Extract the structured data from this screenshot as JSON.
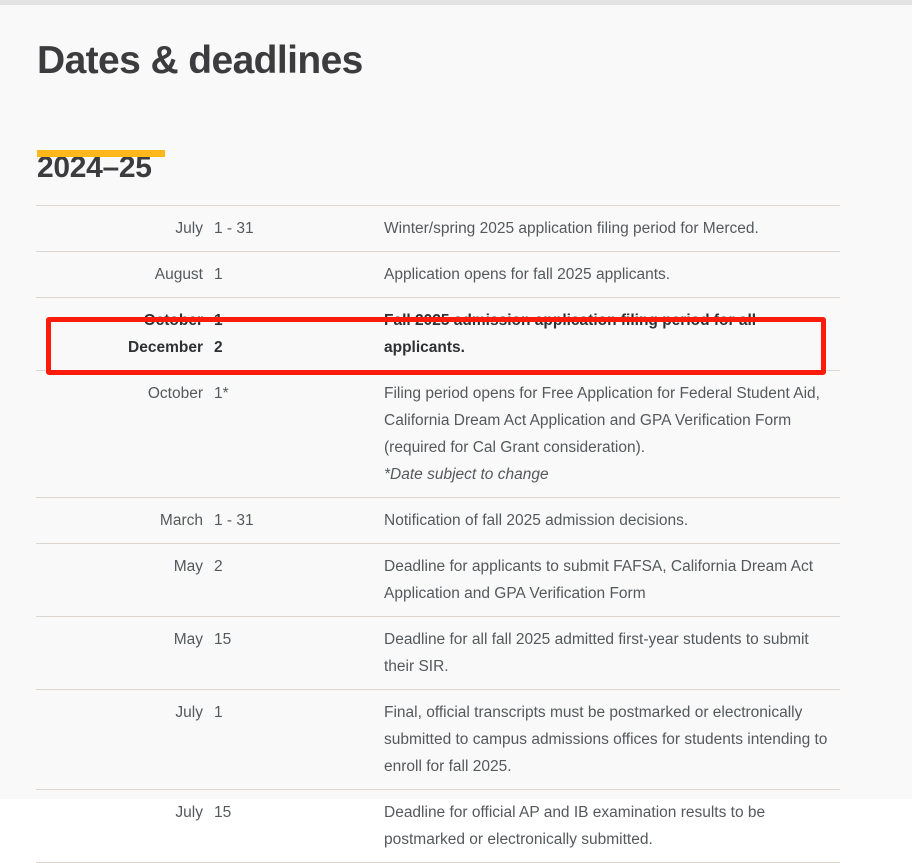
{
  "page": {
    "title": "Dates & deadlines",
    "section_title": "2024–25",
    "accent_color": "#ffb81c",
    "highlight_color": "#fb1c0b",
    "text_color": "#55595c",
    "heading_color": "#3c3c3e",
    "background_color": "#f9f9f9",
    "rule_color": "#dcd6ce"
  },
  "table": {
    "rows": [
      {
        "month": "July",
        "day": "1 - 31",
        "description": "Winter/spring 2025 application filing period for Merced.",
        "note": "",
        "highlighted": false
      },
      {
        "month": "August",
        "day": "1",
        "description": "Application opens for fall 2025 applicants.",
        "note": "",
        "highlighted": false
      },
      {
        "month": "October\nDecember",
        "day": "1 -\n2",
        "description": "Fall 2025 admission application filing period for all applicants.",
        "note": "",
        "highlighted": true
      },
      {
        "month": "October",
        "day": "1*",
        "description": "Filing period opens for Free Application for Federal Student Aid, California Dream Act Application and GPA Verification Form (required for Cal Grant consideration).",
        "note": "*Date subject to change",
        "highlighted": false
      },
      {
        "month": "March",
        "day": "1 - 31",
        "description": "Notification of fall 2025 admission decisions.",
        "note": "",
        "highlighted": false
      },
      {
        "month": "May",
        "day": "2",
        "description": "Deadline for applicants to submit FAFSA, California Dream Act Application and GPA Verification Form",
        "note": "",
        "highlighted": false
      },
      {
        "month": "May",
        "day": "15",
        "description": "Deadline for all fall 2025 admitted first-year students to submit their SIR.",
        "note": "",
        "highlighted": false
      },
      {
        "month": "July",
        "day": "1",
        "description": "Final, official transcripts must be postmarked or electronically submitted to campus admissions offices for students intending to enroll for fall 2025.",
        "note": "",
        "highlighted": false
      },
      {
        "month": "July",
        "day": "15",
        "description": "Deadline for official AP and IB examination results to be postmarked or electronically submitted.",
        "note": "",
        "highlighted": false
      }
    ]
  }
}
